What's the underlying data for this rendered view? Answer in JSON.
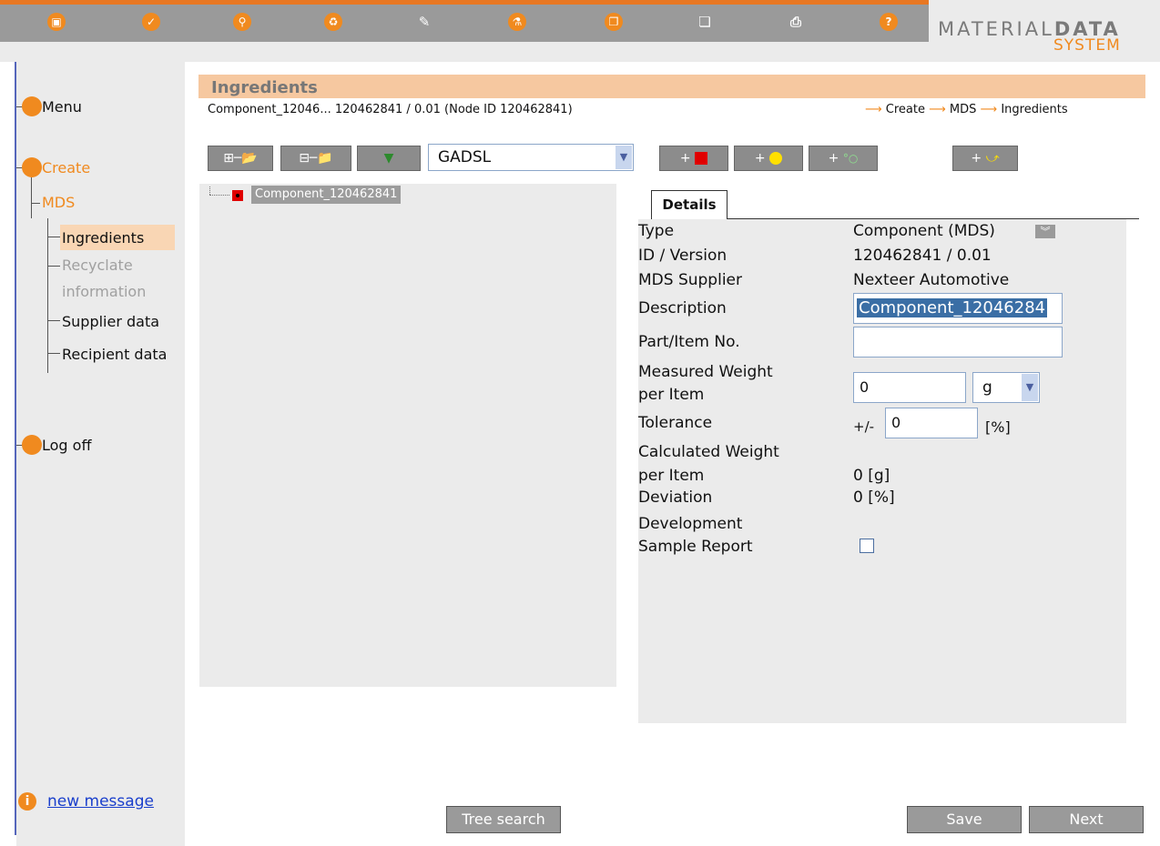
{
  "brand": {
    "line1a": "MATERIAL",
    "line1b": "DATA",
    "line2": "SYSTEM"
  },
  "toolbar_icons": [
    "save-icon",
    "check-icon",
    "search-icon",
    "recycle-icon",
    "edit-icon",
    "lab-flask-icon",
    "copy-icon",
    "paste-icon",
    "print-icon",
    "help-icon"
  ],
  "nav": {
    "menu": "Menu",
    "create": "Create",
    "mds": "MDS",
    "ingredients": "Ingredients",
    "recycle1": "Recyclate",
    "recycle2": "information",
    "supplier": "Supplier data",
    "recipient": "Recipient data",
    "logoff": "Log off"
  },
  "header": {
    "title": "Ingredients",
    "subtitle": "Component_12046... 120462841 / 0.01 (Node ID 120462841)",
    "crumbs": [
      "Create",
      "MDS",
      "Ingredients"
    ]
  },
  "filter": {
    "selected": "GADSL"
  },
  "tree": {
    "node": "Component_120462841"
  },
  "details": {
    "tab": "Details",
    "type_label": "Type",
    "type_value": "Component (MDS)",
    "id_label": "ID / Version",
    "id_value": "120462841 / 0.01",
    "supplier_label": "MDS Supplier",
    "supplier_value": "Nexteer Automotive",
    "desc_label": "Description",
    "desc_value": "Component_12046284",
    "part_label": "Part/Item No.",
    "part_value": "",
    "mw_label1": "Measured Weight",
    "mw_label2": "per Item",
    "mw_value": "0",
    "mw_unit": "g",
    "tol_label": "Tolerance",
    "tol_prefix": "+/-",
    "tol_value": "0",
    "tol_unit": "[%]",
    "cw_label1": "Calculated Weight",
    "cw_label2": "per Item",
    "cw_value": "0 [g]",
    "dev_label": "Deviation",
    "dev_value": "0 [%]",
    "dsr_label1": "Development",
    "dsr_label2": "Sample Report"
  },
  "footer": {
    "message": "new message",
    "tree_search": "Tree search",
    "save": "Save",
    "next": "Next"
  }
}
